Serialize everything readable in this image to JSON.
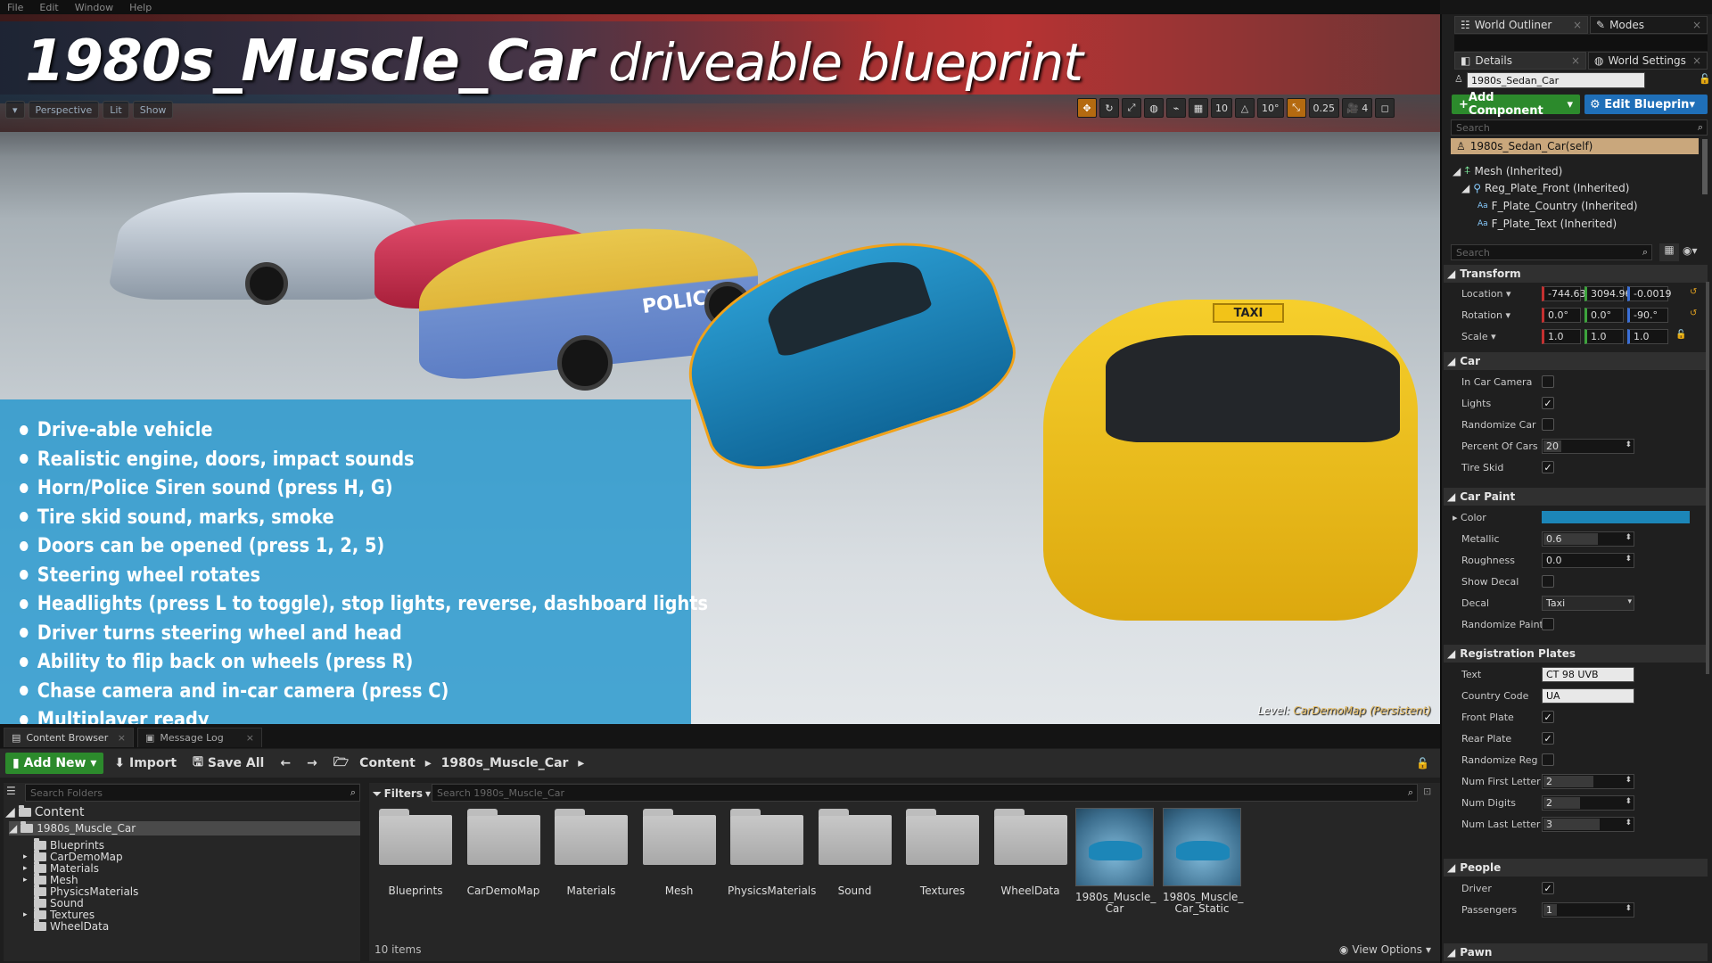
{
  "menu": [
    "File",
    "Edit",
    "Window",
    "Help"
  ],
  "title": {
    "main": "1980s_Muscle_Car",
    "sub": " driveable blueprint"
  },
  "viewport": {
    "toolbar": [
      "Perspective",
      "Lit",
      "Show"
    ],
    "snap": [
      "10",
      "10°",
      "0.25",
      "4"
    ],
    "level_prefix": "Level: ",
    "level_name": "CarDemoMap (Persistent)",
    "car_labels": {
      "police": "POLICE",
      "taxi": "TAXI"
    }
  },
  "features": [
    "Drive-able vehicle",
    "Realistic engine, doors, impact sounds",
    "Horn/Police Siren sound (press H, G)",
    "Tire skid sound, marks, smoke",
    "Doors can be opened (press 1, 2, 5)",
    "Steering wheel rotates",
    "Headlights (press L to toggle), stop lights, reverse, dashboard lights",
    "Driver turns steering wheel and head",
    "Ability to flip back on wheels (press R)",
    "Chase camera and in-car camera (press C)",
    "Multiplayer ready"
  ],
  "content_browser": {
    "tabs": [
      "Content Browser",
      "Message Log"
    ],
    "toolbar": {
      "add_new": "Add New",
      "import": "Import",
      "save_all": "Save All"
    },
    "breadcrumb": [
      "Content",
      "1980s_Muscle_Car"
    ],
    "search_folders": "Search Folders",
    "filters": "Filters",
    "search_assets": "Search 1980s_Muscle_Car",
    "tree": {
      "root": "Content",
      "selected": "1980s_Muscle_Car",
      "children": [
        "Blueprints",
        "CarDemoMap",
        "Materials",
        "Mesh",
        "PhysicsMaterials",
        "Sound",
        "Textures",
        "WheelData"
      ]
    },
    "assets": [
      "Blueprints",
      "CarDemoMap",
      "Materials",
      "Mesh",
      "PhysicsMaterials",
      "Sound",
      "Textures",
      "WheelData"
    ],
    "blueprints": [
      "1980s_Muscle_\nCar",
      "1980s_Muscle_\nCar_Static"
    ],
    "item_count": "10 items",
    "view_options": "View Options"
  },
  "right_panel": {
    "tabs": [
      "World Outliner",
      "Modes",
      "Details",
      "World Settings"
    ],
    "actor_name": "1980s_Sedan_Car",
    "add_component": "Add Component",
    "edit_blueprint": "Edit Blueprin",
    "search": "Search",
    "components": [
      "1980s_Sedan_Car(self)",
      "Mesh (Inherited)",
      "Reg_Plate_Front (Inherited)",
      "F_Plate_Country (Inherited)",
      "F_Plate_Text (Inherited)"
    ],
    "search2": "Search",
    "transform": {
      "header": "Transform",
      "location_label": "Location",
      "rotation_label": "Rotation",
      "scale_label": "Scale",
      "location": [
        "-744.63",
        "3094.96",
        "-0.0019"
      ],
      "rotation": [
        "0.0°",
        "0.0°",
        "-90.°"
      ],
      "scale": [
        "1.0",
        "1.0",
        "1.0"
      ]
    },
    "car": {
      "header": "Car",
      "in_car_camera": "In Car Camera",
      "lights": "Lights",
      "randomize_car": "Randomize Car",
      "percent_of_cars": "Percent Of Cars",
      "percent_value": "20",
      "tire_skid": "Tire Skid"
    },
    "car_paint": {
      "header": "Car Paint",
      "color": "Color",
      "color_hex": "#1c86b8",
      "metallic": "Metallic",
      "metallic_value": "0.6",
      "roughness": "Roughness",
      "roughness_value": "0.0",
      "show_decal": "Show Decal",
      "decal": "Decal",
      "decal_value": "Taxi",
      "randomize_paint": "Randomize Paint"
    },
    "plates": {
      "header": "Registration Plates",
      "text": "Text",
      "text_value": "CT 98 UVB",
      "country_code": "Country Code",
      "country_value": "UA",
      "front_plate": "Front Plate",
      "rear_plate": "Rear Plate",
      "randomize_reg": "Randomize Reg I",
      "num_first": "Num First Letter",
      "num_first_value": "2",
      "num_digits": "Num Digits",
      "num_digits_value": "2",
      "num_last": "Num Last Letter",
      "num_last_value": "3"
    },
    "people": {
      "header": "People",
      "driver": "Driver",
      "passengers": "Passengers",
      "passengers_value": "1"
    },
    "pawn_header": "Pawn"
  },
  "colors": {
    "feature_panel": "#2396cd",
    "add_button": "#2c8a2c",
    "edit_button": "#1f6fb8",
    "taxi": "#f2c318",
    "muscle_car": "#1c86b8"
  }
}
